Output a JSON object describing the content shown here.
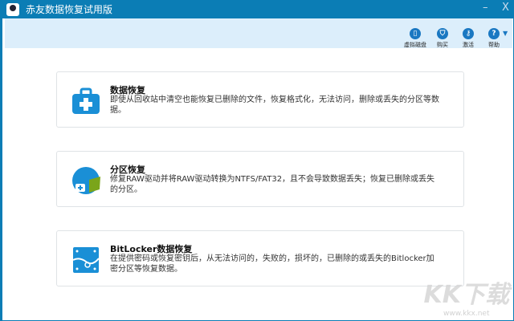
{
  "window": {
    "title": "赤友数据恢复试用版",
    "minimize": "–",
    "close": "X"
  },
  "toolbar": [
    {
      "label": "虚拟磁盘",
      "icon": "disk-icon"
    },
    {
      "label": "购买",
      "icon": "cart-icon"
    },
    {
      "label": "激活",
      "icon": "key-icon"
    },
    {
      "label": "帮助",
      "icon": "help-icon"
    }
  ],
  "cards": [
    {
      "title": "数据恢复",
      "desc": "即使从回收站中清空也能恢复已删除的文件，恢复格式化，无法访问，删除或丢失的分区等数据。"
    },
    {
      "title": "分区恢复",
      "desc": "修复RAW驱动并将RAW驱动转换为NTFS/FAT32，且不会导致数据丢失；恢复已删除或丢失的分区。"
    },
    {
      "title": "BitLocker数据恢复",
      "desc": "在提供密码或恢复密钥后，从无法访问的，失败的，损坏的，已删除的或丢失的Bitlocker加密分区等恢复数据。"
    }
  ],
  "watermark": {
    "brand": "KK下载",
    "url": "www.kkx.net"
  },
  "colors": {
    "accent": "#0b7db5",
    "toolbar": "#dceefb",
    "icon": "#1a8fd6",
    "green": "#7aa51a"
  }
}
